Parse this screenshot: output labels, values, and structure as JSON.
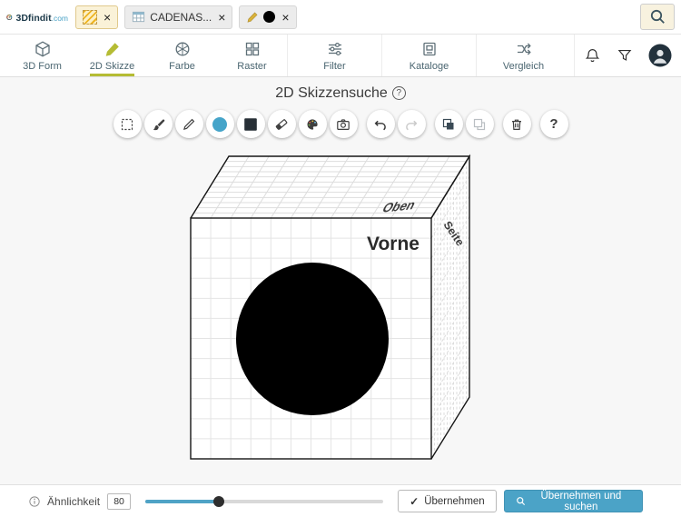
{
  "header": {
    "brand": "3Dfindit",
    "brand_tld": ".com",
    "chips": [
      {
        "icon": "hatch-swatch",
        "label": "",
        "close": "×",
        "selected": true
      },
      {
        "icon": "catalog-table",
        "label": "CADENAS...",
        "close": "×",
        "selected": false
      },
      {
        "icon": "pencil-and-black-circle",
        "label": "",
        "close": "×",
        "selected": false
      }
    ]
  },
  "tabs": [
    {
      "label": "3D Form",
      "icon": "cube",
      "active": false
    },
    {
      "label": "2D Skizze",
      "icon": "pencil",
      "active": true
    },
    {
      "label": "Farbe",
      "icon": "color-wheel",
      "active": false
    },
    {
      "label": "Raster",
      "icon": "raster-grid",
      "active": false
    },
    {
      "label": "Filter",
      "icon": "filter-sliders",
      "active": false
    },
    {
      "label": "Kataloge",
      "icon": "catalog",
      "active": false
    },
    {
      "label": "Vergleich",
      "icon": "compare-arrows",
      "active": false
    }
  ],
  "page": {
    "title": "2D Skizzensuche",
    "help_label": "?"
  },
  "toolbar": {
    "tools": [
      {
        "name": "marquee-select"
      },
      {
        "name": "brush"
      },
      {
        "name": "pencil"
      },
      {
        "name": "filled-circle",
        "active": true
      },
      {
        "name": "filled-rectangle"
      },
      {
        "name": "eraser"
      },
      {
        "name": "palette"
      },
      {
        "name": "camera"
      },
      {
        "name": "undo"
      },
      {
        "name": "redo",
        "disabled": true
      },
      {
        "name": "bring-forward"
      },
      {
        "name": "send-backward"
      },
      {
        "name": "delete"
      },
      {
        "name": "help",
        "label": "?"
      }
    ]
  },
  "canvas": {
    "face_labels": {
      "front": "Vorne",
      "top": "Oben",
      "side": "Seite"
    }
  },
  "footer": {
    "similarity_label": "Ähnlichkeit",
    "similarity_value": "80",
    "slider_percent": 31,
    "apply_check_icon": "✓",
    "apply_button": "Übernehmen",
    "apply_search_button": "Übernehmen und suchen"
  },
  "colors": {
    "accent": "#4BA3C7",
    "active_tool_fill": "#45A4C9",
    "active_tab_icon": "#B5BC34",
    "chip_selected_bg": "#FAF2D8"
  }
}
